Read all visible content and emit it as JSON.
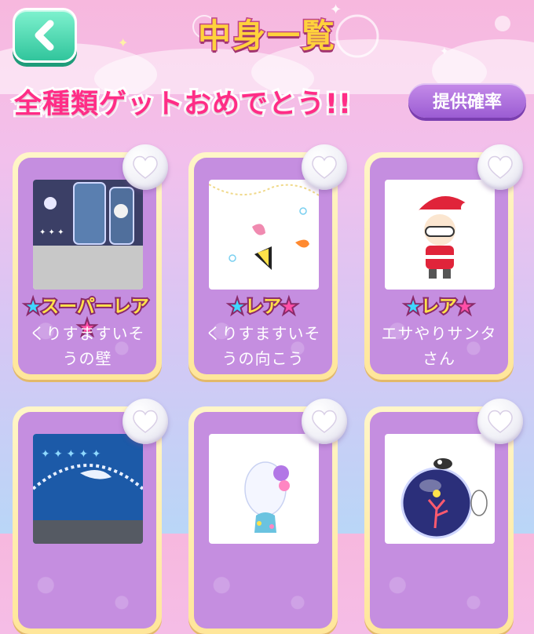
{
  "header": {
    "title": "中身一覧",
    "back_icon": "chevron-left-icon"
  },
  "banner": {
    "text": "全種類ゲットおめでとう!!",
    "rates_button": "提供確率"
  },
  "items": [
    {
      "rarity": "スーパーレア",
      "name": "くりすますいそうの壁",
      "favorite_icon": "heart-icon"
    },
    {
      "rarity": "レア",
      "name": "くりすますいそうの向こう",
      "favorite_icon": "heart-icon"
    },
    {
      "rarity": "レア",
      "name": "エサやりサンタさん",
      "favorite_icon": "heart-icon"
    },
    {
      "rarity": "",
      "name": "",
      "favorite_icon": "heart-icon"
    },
    {
      "rarity": "",
      "name": "",
      "favorite_icon": "heart-icon"
    },
    {
      "rarity": "",
      "name": "",
      "favorite_icon": "heart-icon"
    }
  ],
  "colors": {
    "title_fill": "#ffd23c",
    "banner_text": "#ff2d86",
    "back_button": "#31c59c",
    "rates_button": "#9b5cd3",
    "card_frame": "#ffe69a",
    "card_body": "#c58ee0"
  }
}
